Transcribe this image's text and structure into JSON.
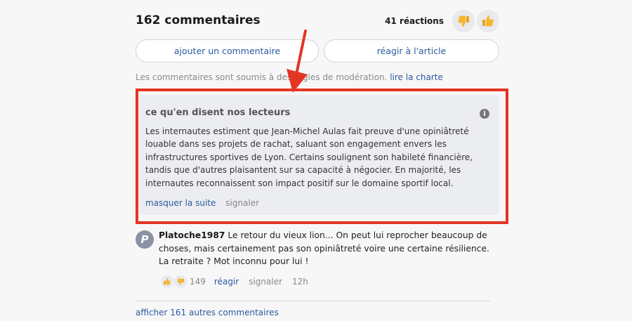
{
  "header": {
    "title": "162 commentaires",
    "reactions_count": "41 réactions",
    "reaction_down_icon": "thumbs-down-emoji",
    "reaction_up_icon": "thumbs-up-emoji"
  },
  "actions": {
    "add_comment": "ajouter un commentaire",
    "react_article": "réagir à l'article"
  },
  "moderation": {
    "text": "Les commentaires sont soumis à des règles de modération.",
    "link": "lire la charte"
  },
  "summary": {
    "title": "ce qu'en disent nos lecteurs",
    "body": "Les internautes estiment que Jean-Michel Aulas fait preuve d'une opiniâtreté louable dans ses projets de rachat, saluant son engagement envers les infrastructures sportives de Lyon. Certains soulignent son habileté financière, tandis que d'autres plaisantent sur sa capacité à négocier. En majorité, les internautes reconnaissent son impact positif sur le domaine sportif local.",
    "hide_label": "masquer la suite",
    "report_label": "signaler",
    "highlight_color": "#e33524"
  },
  "comment": {
    "avatar_letter": "P",
    "author": "Platoche1987",
    "text": " Le retour du vieux lion... On peut lui reprocher beaucoup de choses, mais certainement pas son opiniâtreté voire une certaine résilience. La retraite ? Mot inconnu pour lui !",
    "reactions": "149",
    "reply_label": "réagir",
    "report_label": "signaler",
    "time": "12h"
  },
  "footer": {
    "show_more": "afficher 161 autres commentaires"
  },
  "colors": {
    "link": "#2c5aa0",
    "background": "#f7f7f7",
    "summary_background": "#ecedf1"
  }
}
